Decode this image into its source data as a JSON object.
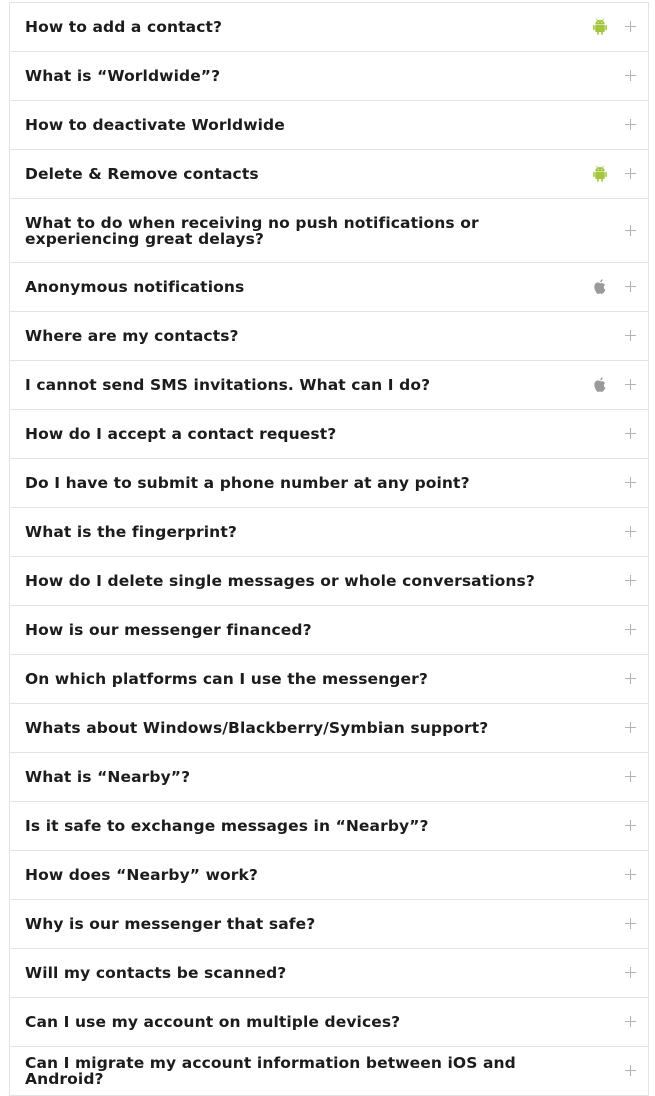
{
  "colors": {
    "android": "#a4c639",
    "apple": "#9a9a9a",
    "border": "#e3e3e3",
    "text": "#1c1c1c",
    "plus": "#b3b3b3"
  },
  "faq": {
    "items": [
      {
        "question": "How to add a contact?",
        "platform": "android-icon"
      },
      {
        "question": "What is “Worldwide”?",
        "platform": ""
      },
      {
        "question": "How to deactivate Worldwide",
        "platform": ""
      },
      {
        "question": "Delete & Remove contacts",
        "platform": "android-icon"
      },
      {
        "question": "What to do when receiving no push notifications or experiencing great delays?",
        "platform": ""
      },
      {
        "question": "Anonymous notifications",
        "platform": "apple-icon"
      },
      {
        "question": "Where are my contacts?",
        "platform": ""
      },
      {
        "question": "I cannot send SMS invitations. What can I do?",
        "platform": "apple-icon"
      },
      {
        "question": "How do I accept a contact request?",
        "platform": ""
      },
      {
        "question": "Do I have to submit a phone number at any point?",
        "platform": ""
      },
      {
        "question": "What is the fingerprint?",
        "platform": ""
      },
      {
        "question": "How do I delete single messages or whole conversations?",
        "platform": ""
      },
      {
        "question": "How is our messenger financed?",
        "platform": ""
      },
      {
        "question": "On which platforms can I use the messenger?",
        "platform": ""
      },
      {
        "question": "Whats about Windows/Blackberry/Symbian support?",
        "platform": ""
      },
      {
        "question": "What is “Nearby”?",
        "platform": ""
      },
      {
        "question": "Is it safe to exchange messages in “Nearby”?",
        "platform": ""
      },
      {
        "question": "How does “Nearby” work?",
        "platform": ""
      },
      {
        "question": "Why is our messenger that safe?",
        "platform": ""
      },
      {
        "question": "Will my contacts be scanned?",
        "platform": ""
      },
      {
        "question": "Can I use my account on multiple devices?",
        "platform": ""
      },
      {
        "question": "Can I migrate my account information between iOS and Android?",
        "platform": ""
      }
    ]
  }
}
